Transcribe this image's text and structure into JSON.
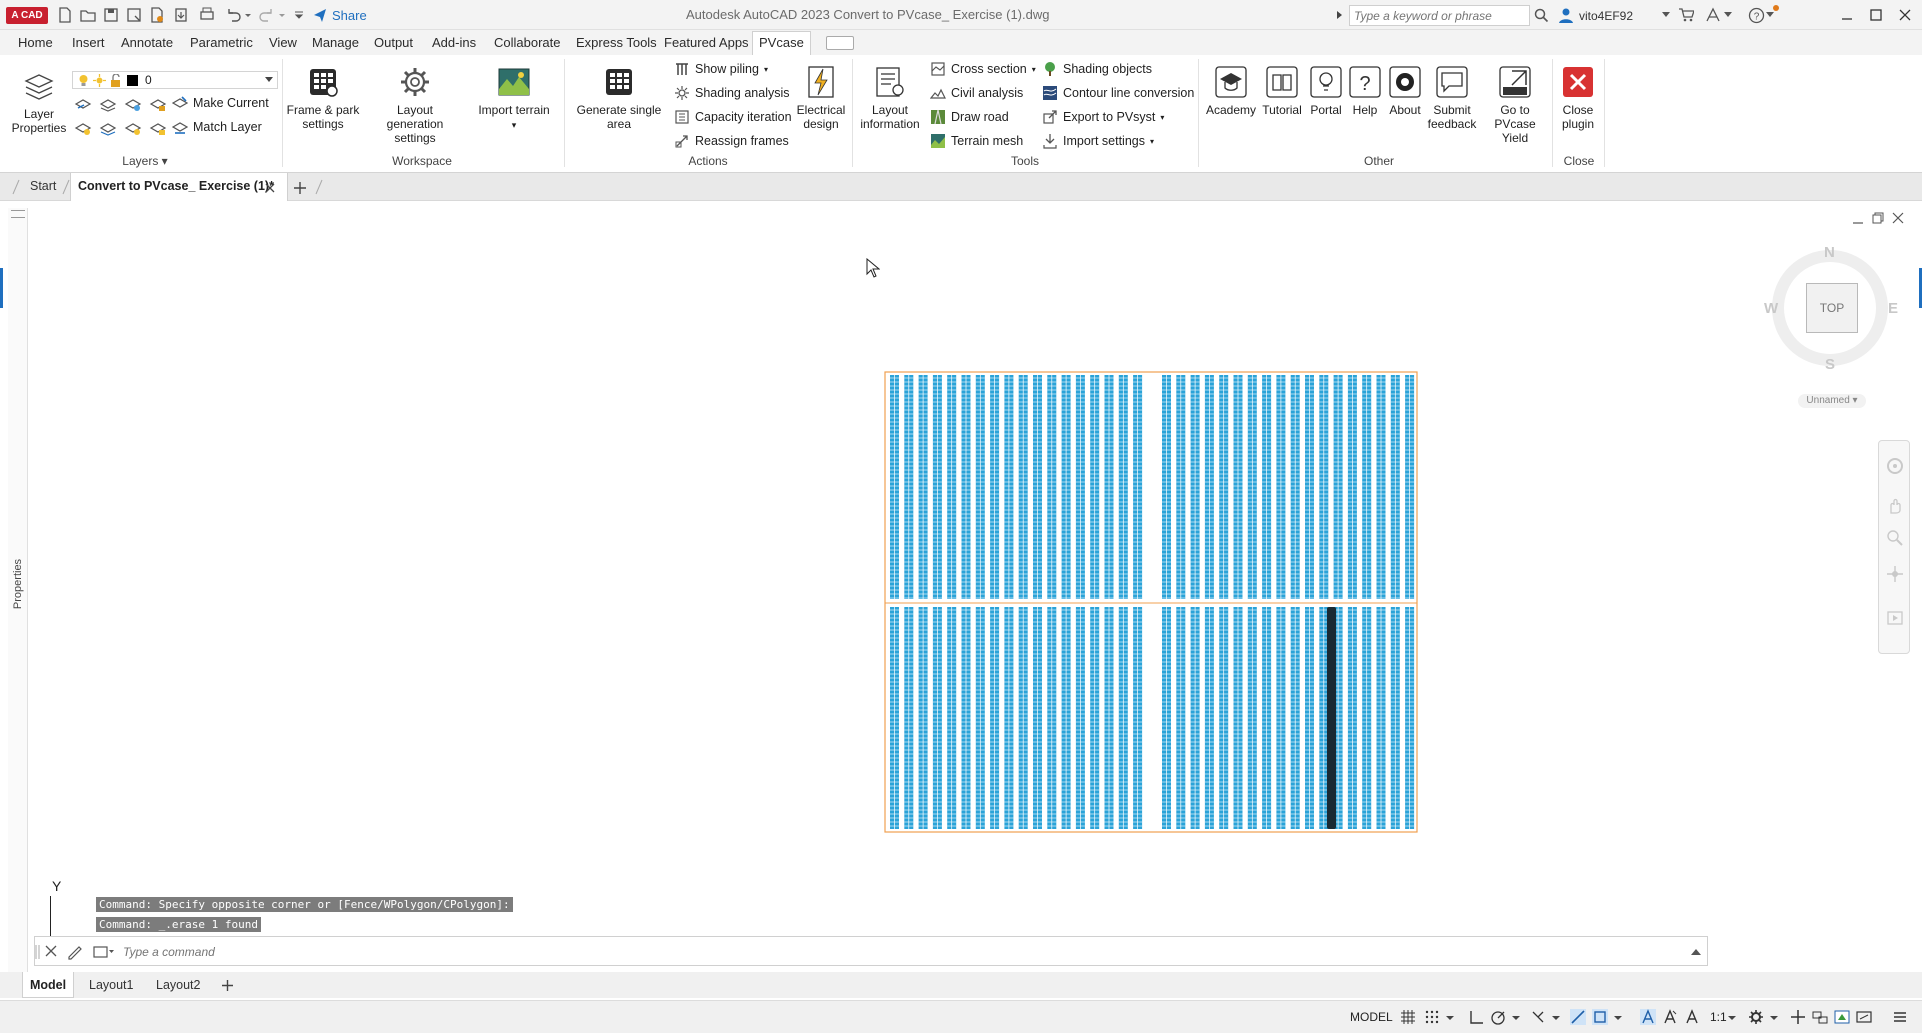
{
  "titlebar": {
    "app_badge": "A CAD",
    "share_label": "Share",
    "title": "Autodesk AutoCAD 2023   Convert to PVcase_ Exercise (1).dwg",
    "search_placeholder": "Type a keyword or phrase",
    "user": "vito4EF92"
  },
  "ribbon_tabs": [
    "Home",
    "Insert",
    "Annotate",
    "Parametric",
    "View",
    "Manage",
    "Output",
    "Add-ins",
    "Collaborate",
    "Express Tools",
    "Featured Apps",
    "PVcase"
  ],
  "ribbon": {
    "layers": {
      "layer_properties": "Layer Properties",
      "current_layer": "0",
      "make_current": "Make Current",
      "match_layer": "Match Layer",
      "title": "Layers"
    },
    "workspace": {
      "frame_park": "Frame & park settings",
      "layout_gen": "Layout generation settings",
      "import_terrain": "Import terrain",
      "title": "Workspace"
    },
    "actions": {
      "generate_single": "Generate single area",
      "show_piling": "Show piling",
      "shading_analysis": "Shading analysis",
      "capacity_iteration": "Capacity iteration",
      "reassign_frames": "Reassign frames",
      "electrical_design": "Electrical design",
      "title": "Actions"
    },
    "tools": {
      "layout_info": "Layout information",
      "cross_section": "Cross section",
      "civil_analysis": "Civil analysis",
      "draw_road": "Draw road",
      "terrain_mesh": "Terrain mesh",
      "shading_objects": "Shading objects",
      "contour_conversion": "Contour line conversion",
      "export_pvsyst": "Export to PVsyst",
      "import_settings": "Import settings",
      "title": "Tools"
    },
    "other": {
      "academy": "Academy",
      "tutorial": "Tutorial",
      "portal": "Portal",
      "help": "Help",
      "about": "About",
      "submit_feedback": "Submit feedback",
      "pvcase_yield": "Go to PVcase Yield",
      "title": "Other"
    },
    "close": {
      "close_plugin": "Close plugin",
      "title": "Close"
    }
  },
  "doc_tabs": {
    "start": "Start",
    "active": "Convert to PVcase_ Exercise (1)*"
  },
  "side_palette": "Properties",
  "viewcube": {
    "n": "N",
    "s": "S",
    "e": "E",
    "w": "W",
    "face": "TOP",
    "ucs": "Unnamed"
  },
  "ucs_axis": "Y",
  "command_history": [
    "Command: Specify opposite corner or [Fence/WPolygon/CPolygon]:",
    "Command: _.erase 1 found"
  ],
  "command_placeholder": "Type a command",
  "layout_tabs": [
    "Model",
    "Layout1",
    "Layout2"
  ],
  "status": {
    "model": "MODEL",
    "scale": "1:1"
  },
  "colors": {
    "panel_blue": "#2aa3d8",
    "boundary_orange": "#f0a050",
    "highlight_row": "#1a2a33",
    "close_red": "#d83232"
  }
}
